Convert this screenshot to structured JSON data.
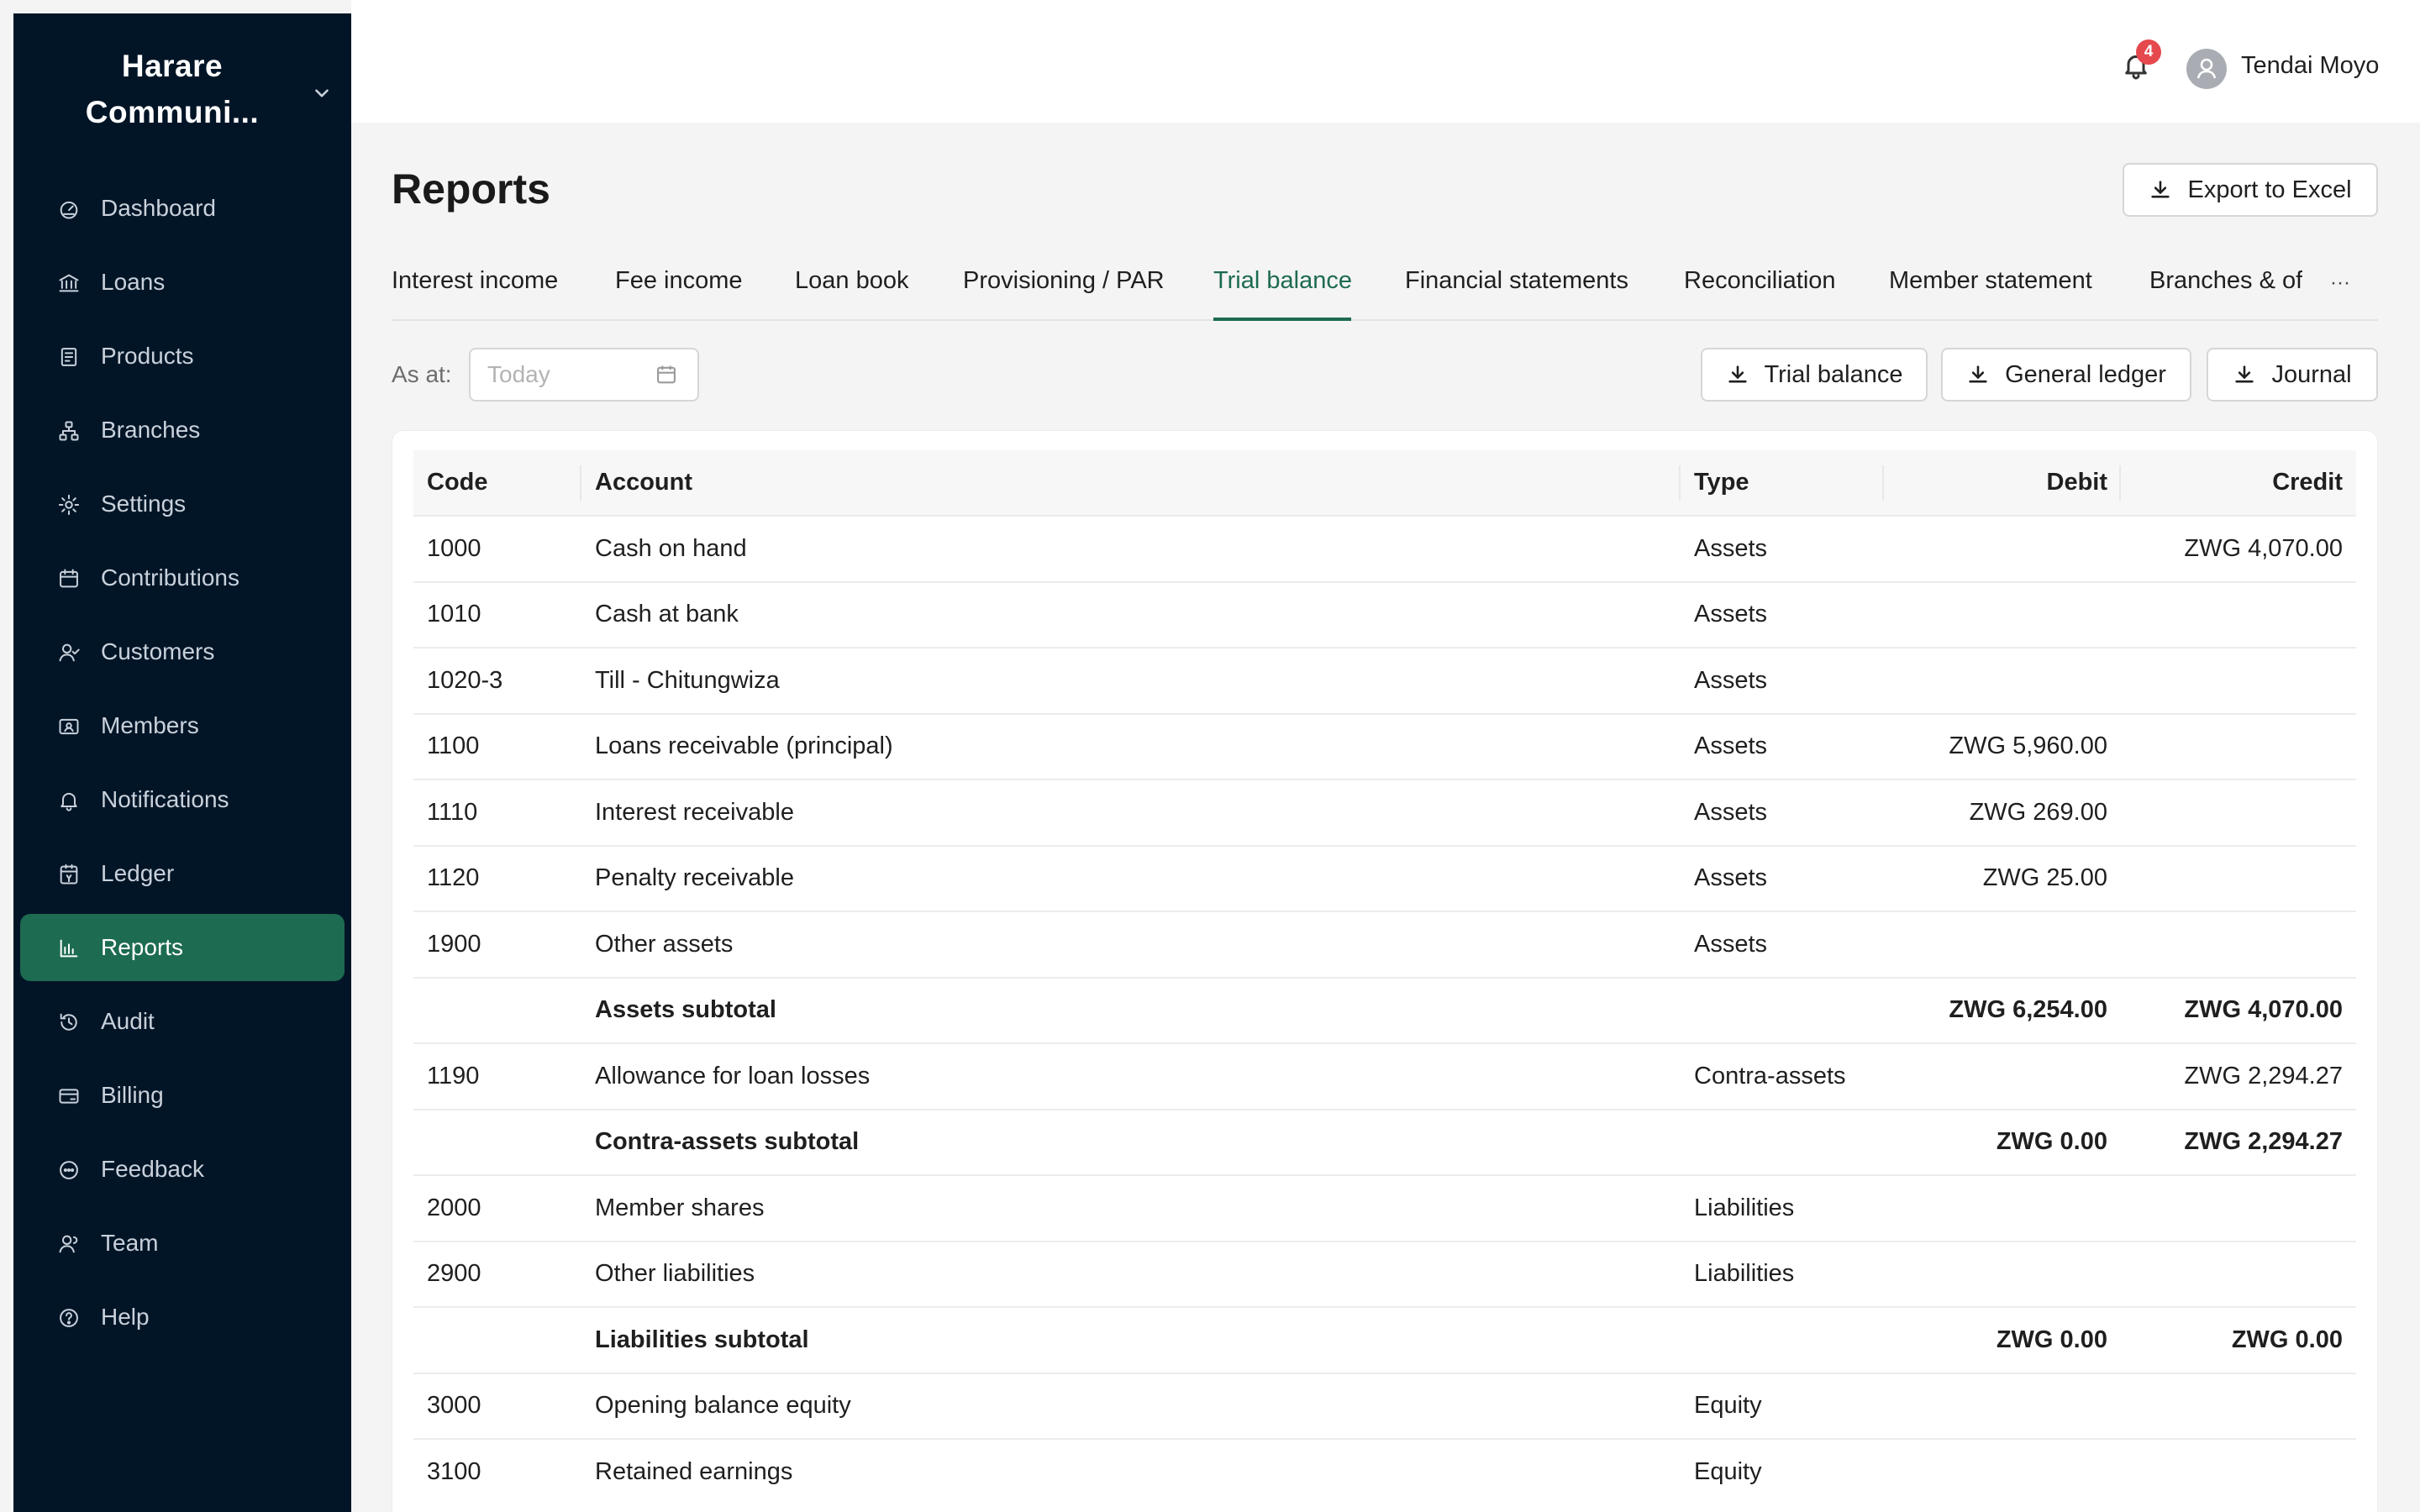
{
  "sidebar": {
    "org_name": "Harare Communi...",
    "items": [
      {
        "label": "Dashboard",
        "icon": "dashboard-icon"
      },
      {
        "label": "Loans",
        "icon": "bank-icon"
      },
      {
        "label": "Products",
        "icon": "products-icon"
      },
      {
        "label": "Branches",
        "icon": "branches-icon"
      },
      {
        "label": "Settings",
        "icon": "gear-icon"
      },
      {
        "label": "Contributions",
        "icon": "calendar-icon"
      },
      {
        "label": "Customers",
        "icon": "users-icon"
      },
      {
        "label": "Members",
        "icon": "id-card-icon"
      },
      {
        "label": "Notifications",
        "icon": "bell-icon"
      },
      {
        "label": "Ledger",
        "icon": "ledger-icon"
      },
      {
        "label": "Reports",
        "icon": "bar-chart-icon",
        "active": true
      },
      {
        "label": "Audit",
        "icon": "history-icon"
      },
      {
        "label": "Billing",
        "icon": "card-icon"
      },
      {
        "label": "Feedback",
        "icon": "chat-icon"
      },
      {
        "label": "Team",
        "icon": "team-icon"
      },
      {
        "label": "Help",
        "icon": "help-icon"
      }
    ]
  },
  "header": {
    "notification_count": "4",
    "user_name": "Tendai Moyo"
  },
  "page": {
    "title": "Reports",
    "export_label": "Export to Excel"
  },
  "tabs": [
    "Interest income",
    "Fee income",
    "Loan book",
    "Provisioning / PAR",
    "Trial balance",
    "Financial statements",
    "Reconciliation",
    "Member statement",
    "Branches & of"
  ],
  "active_tab": "Trial balance",
  "tabs_more": "···",
  "filters": {
    "as_at_label": "As at:",
    "date_placeholder": "Today"
  },
  "downloads": {
    "trial_balance": "Trial balance",
    "general_ledger": "General ledger",
    "journal": "Journal"
  },
  "table": {
    "headers": {
      "code": "Code",
      "account": "Account",
      "type": "Type",
      "debit": "Debit",
      "credit": "Credit"
    },
    "rows": [
      {
        "code": "1000",
        "account": "Cash on hand",
        "type": "Assets",
        "debit": "",
        "credit": "ZWG 4,070.00"
      },
      {
        "code": "1010",
        "account": "Cash at bank",
        "type": "Assets",
        "debit": "",
        "credit": ""
      },
      {
        "code": "1020-3",
        "account": "Till - Chitungwiza",
        "type": "Assets",
        "debit": "",
        "credit": ""
      },
      {
        "code": "1100",
        "account": "Loans receivable (principal)",
        "type": "Assets",
        "debit": "ZWG 5,960.00",
        "credit": ""
      },
      {
        "code": "1110",
        "account": "Interest receivable",
        "type": "Assets",
        "debit": "ZWG 269.00",
        "credit": ""
      },
      {
        "code": "1120",
        "account": "Penalty receivable",
        "type": "Assets",
        "debit": "ZWG 25.00",
        "credit": ""
      },
      {
        "code": "1900",
        "account": "Other assets",
        "type": "Assets",
        "debit": "",
        "credit": ""
      },
      {
        "code": "",
        "account": "Assets subtotal",
        "type": "",
        "debit": "ZWG 6,254.00",
        "credit": "ZWG 4,070.00",
        "subtotal": true
      },
      {
        "code": "1190",
        "account": "Allowance for loan losses",
        "type": "Contra-assets",
        "debit": "",
        "credit": "ZWG 2,294.27"
      },
      {
        "code": "",
        "account": "Contra-assets subtotal",
        "type": "",
        "debit": "ZWG 0.00",
        "credit": "ZWG 2,294.27",
        "subtotal": true
      },
      {
        "code": "2000",
        "account": "Member shares",
        "type": "Liabilities",
        "debit": "",
        "credit": ""
      },
      {
        "code": "2900",
        "account": "Other liabilities",
        "type": "Liabilities",
        "debit": "",
        "credit": ""
      },
      {
        "code": "",
        "account": "Liabilities subtotal",
        "type": "",
        "debit": "ZWG 0.00",
        "credit": "ZWG 0.00",
        "subtotal": true
      },
      {
        "code": "3000",
        "account": "Opening balance equity",
        "type": "Equity",
        "debit": "",
        "credit": ""
      },
      {
        "code": "3100",
        "account": "Retained earnings",
        "type": "Equity",
        "debit": "",
        "credit": ""
      }
    ]
  },
  "colors": {
    "sidebar_bg": "#021527",
    "accent": "#1d6b51",
    "badge": "#e5484d"
  }
}
